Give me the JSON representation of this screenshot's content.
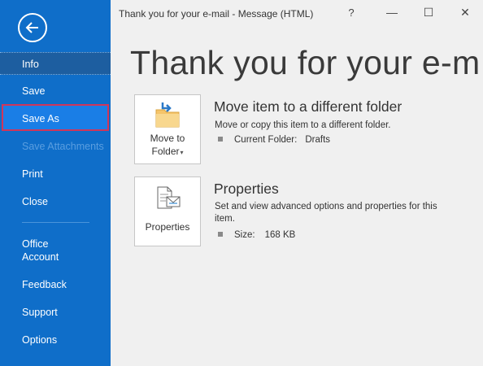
{
  "window": {
    "title": "Thank you for your e-mail  -  Message (HTML)",
    "help": "?",
    "minimize": "—",
    "maximize": "☐",
    "close": "✕"
  },
  "sidebar": {
    "back_icon": "back-arrow-icon",
    "items": [
      {
        "label": "Info",
        "state": "selected"
      },
      {
        "label": "Save"
      },
      {
        "label": "Save As",
        "state": "highlighted"
      },
      {
        "label": "Save Attachments",
        "state": "disabled"
      },
      {
        "label": "Print"
      },
      {
        "label": "Close"
      },
      {
        "label": "Office\nAccount"
      },
      {
        "label": "Feedback"
      },
      {
        "label": "Support"
      },
      {
        "label": "Options"
      }
    ]
  },
  "main": {
    "page_title": "Thank you for your e-mail",
    "move": {
      "button_line1": "Move to",
      "button_line2": "Folder",
      "button_caret": "▾",
      "title": "Move item to a different folder",
      "description": "Move or copy this item to a different folder.",
      "meta_label": "Current Folder:",
      "meta_value": "Drafts"
    },
    "properties": {
      "button_label": "Properties",
      "title": "Properties",
      "description": "Set and view advanced options and properties for this item.",
      "meta_label": "Size:",
      "meta_value": "168 KB"
    }
  },
  "colors": {
    "sidebar": "#0f6ec9",
    "selected": "#1d5ea0",
    "highlight_border": "#d0365a",
    "disabled_text": "#5a9ee0"
  }
}
